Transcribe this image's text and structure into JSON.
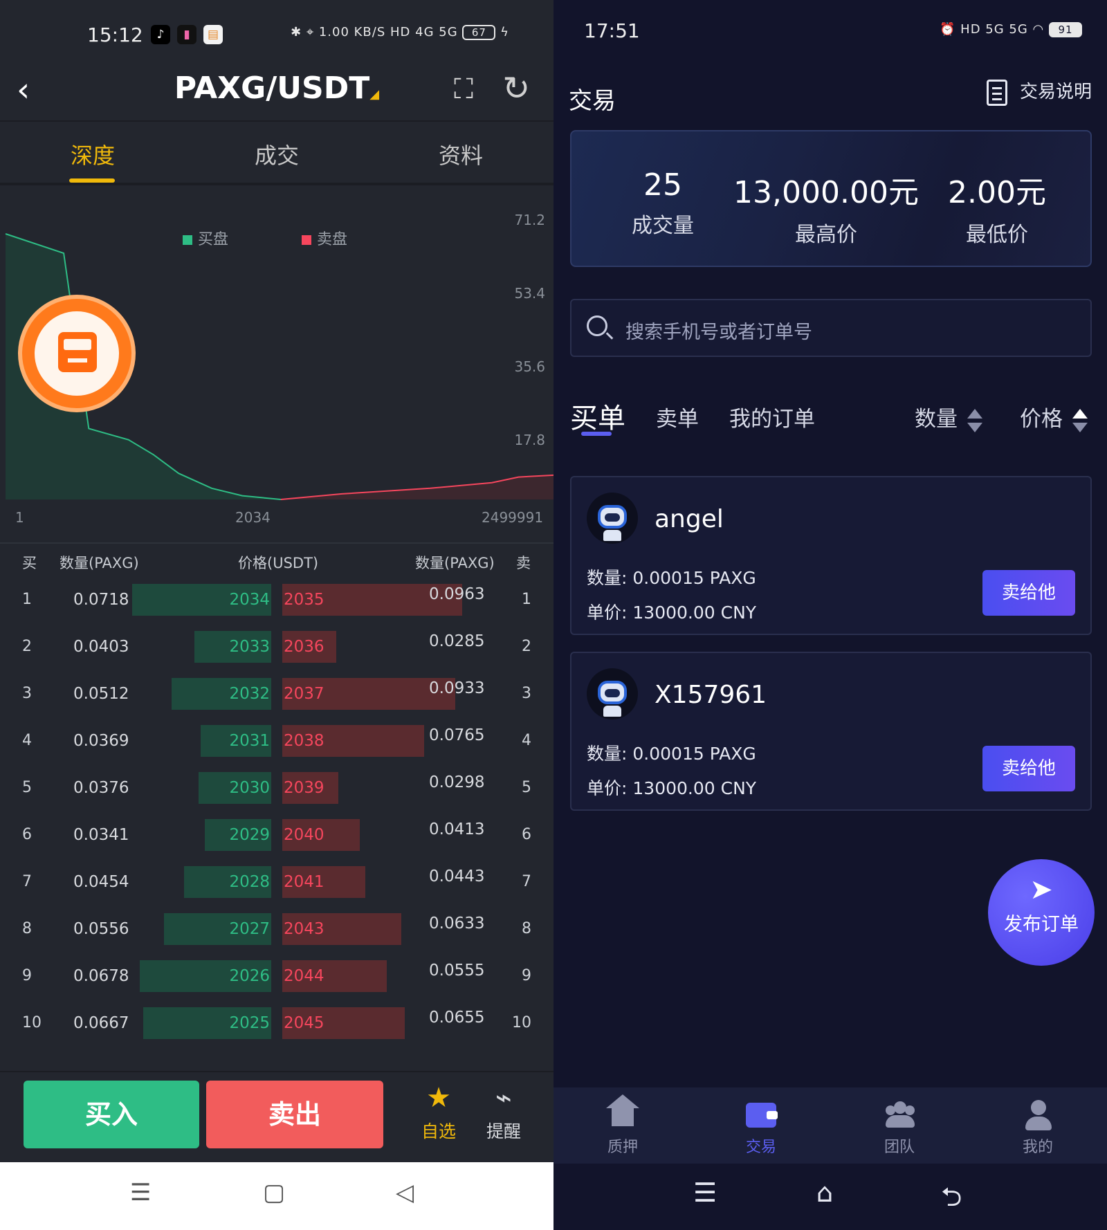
{
  "left": {
    "status": {
      "time": "15:12",
      "net_speed": "1.00 KB/S",
      "signal": "HD 4G 5G",
      "battery": "67"
    },
    "nav": {
      "back_glyph": "‹",
      "pair": "PAXG/USDT",
      "pair_marker": "◢"
    },
    "tabs": [
      "深度",
      "成交",
      "资料"
    ],
    "chart_data": {
      "type": "area",
      "legend": [
        {
          "label": "买盘",
          "color": "#2ebd85"
        },
        {
          "label": "卖盘",
          "color": "#f6465d"
        }
      ],
      "y_ticks": [
        "71.2",
        "53.4",
        "35.6",
        "17.8"
      ],
      "x_ticks": [
        "1",
        "2034",
        "2499991"
      ],
      "ylim": [
        0,
        71.2
      ],
      "bids_series": {
        "name": "买盘",
        "x": [
          "1",
          "5",
          "10",
          "30",
          "60",
          "120",
          "300",
          "700",
          "2034"
        ],
        "values": [
          71.2,
          66,
          19,
          16,
          12,
          7,
          3,
          1,
          0
        ]
      },
      "asks_series": {
        "name": "卖盘",
        "x": [
          "2034",
          "10000",
          "100000",
          "500000",
          "1000000",
          "2499991"
        ],
        "values": [
          0,
          1.5,
          3,
          4.5,
          6,
          6.5
        ]
      }
    },
    "orderbook": {
      "headers": {
        "buy": "买",
        "qty_l": "数量(PAXG)",
        "price": "价格(USDT)",
        "qty_r": "数量(PAXG)",
        "sell": "卖"
      },
      "rows": [
        {
          "n": "1",
          "bq": "0.0718",
          "bp": "2034",
          "sp": "2035",
          "sq": "0.0963",
          "bw": 0.92,
          "sw": 1.0
        },
        {
          "n": "2",
          "bq": "0.0403",
          "bp": "2033",
          "sp": "2036",
          "sq": "0.0285",
          "bw": 0.51,
          "sw": 0.3
        },
        {
          "n": "3",
          "bq": "0.0512",
          "bp": "2032",
          "sp": "2037",
          "sq": "0.0933",
          "bw": 0.66,
          "sw": 0.96
        },
        {
          "n": "4",
          "bq": "0.0369",
          "bp": "2031",
          "sp": "2038",
          "sq": "0.0765",
          "bw": 0.47,
          "sw": 0.79
        },
        {
          "n": "5",
          "bq": "0.0376",
          "bp": "2030",
          "sp": "2039",
          "sq": "0.0298",
          "bw": 0.48,
          "sw": 0.31
        },
        {
          "n": "6",
          "bq": "0.0341",
          "bp": "2029",
          "sp": "2040",
          "sq": "0.0413",
          "bw": 0.44,
          "sw": 0.43
        },
        {
          "n": "7",
          "bq": "0.0454",
          "bp": "2028",
          "sp": "2041",
          "sq": "0.0443",
          "bw": 0.58,
          "sw": 0.46
        },
        {
          "n": "8",
          "bq": "0.0556",
          "bp": "2027",
          "sp": "2043",
          "sq": "0.0633",
          "bw": 0.71,
          "sw": 0.66
        },
        {
          "n": "9",
          "bq": "0.0678",
          "bp": "2026",
          "sp": "2044",
          "sq": "0.0555",
          "bw": 0.87,
          "sw": 0.58
        },
        {
          "n": "10",
          "bq": "0.0667",
          "bp": "2025",
          "sp": "2045",
          "sq": "0.0655",
          "bw": 0.85,
          "sw": 0.68
        }
      ]
    },
    "actions": {
      "buy": "买入",
      "sell": "卖出",
      "fav": "自选",
      "fav_glyph": "★",
      "remind": "提醒",
      "remind_glyph": "⌁"
    },
    "sysnav": {
      "menu": "☰",
      "home": "▢",
      "back": "◁"
    }
  },
  "right": {
    "status": {
      "time": "17:51",
      "signal": "HD 5G 5G",
      "battery": "91"
    },
    "title": "交易",
    "help": "交易说明",
    "stats": [
      {
        "value": "25",
        "label": "成交量"
      },
      {
        "value": "13,000.00元",
        "label": "最高价"
      },
      {
        "value": "2.00元",
        "label": "最低价"
      }
    ],
    "search": {
      "placeholder": "搜索手机号或者订单号"
    },
    "tabs": {
      "buy": "买单",
      "sell": "卖单",
      "mine": "我的订单",
      "qty": "数量",
      "price": "价格"
    },
    "orders": [
      {
        "name": "angel",
        "qty_label": "数量:",
        "qty": "0.00015 PAXG",
        "price_label": "单价:",
        "price": "13000.00 CNY",
        "btn": "卖给他"
      },
      {
        "name": "X157961",
        "qty_label": "数量:",
        "qty": "0.00015 PAXG",
        "price_label": "单价:",
        "price": "13000.00 CNY",
        "btn": "卖给他"
      }
    ],
    "fab": {
      "glyph": "➤",
      "label": "发布订单"
    },
    "tabbar": [
      "质押",
      "交易",
      "团队",
      "我的"
    ],
    "sysnav": {
      "menu": "☰",
      "home": "⌂",
      "back": "⮌"
    }
  }
}
